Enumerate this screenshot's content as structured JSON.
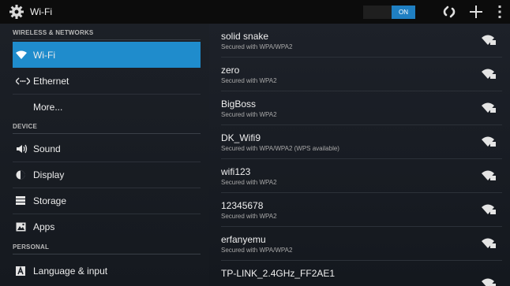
{
  "actionbar": {
    "title": "Wi-Fi",
    "toggle_label": "ON",
    "icons": [
      "settings-gear-icon",
      "wps-icon",
      "add-network-icon",
      "overflow-menu-icon"
    ]
  },
  "sidebar": {
    "sections": {
      "wireless": "WIRELESS & NETWORKS",
      "device": "DEVICE",
      "personal": "PERSONAL"
    },
    "items": {
      "wifi": "Wi-Fi",
      "ethernet": "Ethernet",
      "more": "More...",
      "sound": "Sound",
      "display": "Display",
      "storage": "Storage",
      "apps": "Apps",
      "language": "Language & input"
    },
    "selected": "wifi",
    "accent": "#1f8ccc"
  },
  "networks": [
    {
      "ssid": "solid snake",
      "security": "Secured with WPA/WPA2"
    },
    {
      "ssid": "zero",
      "security": "Secured with WPA2"
    },
    {
      "ssid": "BigBoss",
      "security": "Secured with WPA2"
    },
    {
      "ssid": "DK_Wifi9",
      "security": "Secured with WPA/WPA2 (WPS available)"
    },
    {
      "ssid": "wifi123",
      "security": "Secured with WPA2"
    },
    {
      "ssid": "12345678",
      "security": "Secured with WPA2"
    },
    {
      "ssid": "erfanyemu",
      "security": "Secured with WPA/WPA2"
    },
    {
      "ssid": "TP-LINK_2.4GHz_FF2AE1",
      "security": ""
    }
  ]
}
